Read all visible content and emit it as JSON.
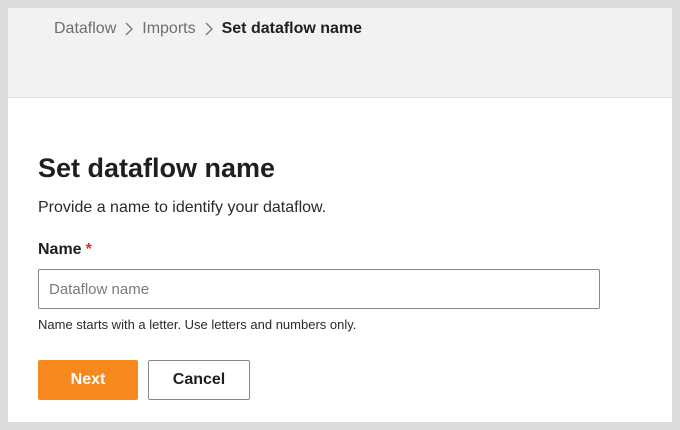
{
  "breadcrumb": {
    "items": [
      {
        "label": "Dataflow"
      },
      {
        "label": "Imports"
      }
    ],
    "current": "Set dataflow name"
  },
  "page": {
    "title": "Set dataflow name",
    "description": "Provide a name to identify your dataflow."
  },
  "form": {
    "name_field": {
      "label": "Name",
      "required_marker": "*",
      "value": "",
      "placeholder": "Dataflow name",
      "hint": "Name starts with a letter. Use letters and numbers only."
    }
  },
  "actions": {
    "next_label": "Next",
    "cancel_label": "Cancel"
  },
  "colors": {
    "primary_button": "#f7891e",
    "required_marker": "#d6322b",
    "header_background": "#f2f2f2"
  },
  "icons": {
    "breadcrumb_separator": "chevron-right-icon"
  }
}
